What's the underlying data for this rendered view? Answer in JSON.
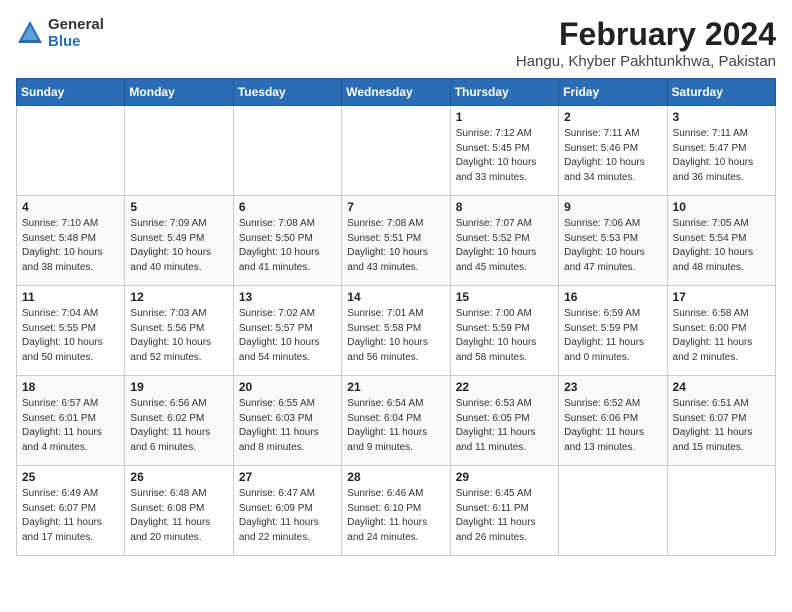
{
  "header": {
    "logo_general": "General",
    "logo_blue": "Blue",
    "month_title": "February 2024",
    "location": "Hangu, Khyber Pakhtunkhwa, Pakistan"
  },
  "days_of_week": [
    "Sunday",
    "Monday",
    "Tuesday",
    "Wednesday",
    "Thursday",
    "Friday",
    "Saturday"
  ],
  "weeks": [
    [
      {
        "day": "",
        "info": ""
      },
      {
        "day": "",
        "info": ""
      },
      {
        "day": "",
        "info": ""
      },
      {
        "day": "",
        "info": ""
      },
      {
        "day": "1",
        "info": "Sunrise: 7:12 AM\nSunset: 5:45 PM\nDaylight: 10 hours\nand 33 minutes."
      },
      {
        "day": "2",
        "info": "Sunrise: 7:11 AM\nSunset: 5:46 PM\nDaylight: 10 hours\nand 34 minutes."
      },
      {
        "day": "3",
        "info": "Sunrise: 7:11 AM\nSunset: 5:47 PM\nDaylight: 10 hours\nand 36 minutes."
      }
    ],
    [
      {
        "day": "4",
        "info": "Sunrise: 7:10 AM\nSunset: 5:48 PM\nDaylight: 10 hours\nand 38 minutes."
      },
      {
        "day": "5",
        "info": "Sunrise: 7:09 AM\nSunset: 5:49 PM\nDaylight: 10 hours\nand 40 minutes."
      },
      {
        "day": "6",
        "info": "Sunrise: 7:08 AM\nSunset: 5:50 PM\nDaylight: 10 hours\nand 41 minutes."
      },
      {
        "day": "7",
        "info": "Sunrise: 7:08 AM\nSunset: 5:51 PM\nDaylight: 10 hours\nand 43 minutes."
      },
      {
        "day": "8",
        "info": "Sunrise: 7:07 AM\nSunset: 5:52 PM\nDaylight: 10 hours\nand 45 minutes."
      },
      {
        "day": "9",
        "info": "Sunrise: 7:06 AM\nSunset: 5:53 PM\nDaylight: 10 hours\nand 47 minutes."
      },
      {
        "day": "10",
        "info": "Sunrise: 7:05 AM\nSunset: 5:54 PM\nDaylight: 10 hours\nand 48 minutes."
      }
    ],
    [
      {
        "day": "11",
        "info": "Sunrise: 7:04 AM\nSunset: 5:55 PM\nDaylight: 10 hours\nand 50 minutes."
      },
      {
        "day": "12",
        "info": "Sunrise: 7:03 AM\nSunset: 5:56 PM\nDaylight: 10 hours\nand 52 minutes."
      },
      {
        "day": "13",
        "info": "Sunrise: 7:02 AM\nSunset: 5:57 PM\nDaylight: 10 hours\nand 54 minutes."
      },
      {
        "day": "14",
        "info": "Sunrise: 7:01 AM\nSunset: 5:58 PM\nDaylight: 10 hours\nand 56 minutes."
      },
      {
        "day": "15",
        "info": "Sunrise: 7:00 AM\nSunset: 5:59 PM\nDaylight: 10 hours\nand 58 minutes."
      },
      {
        "day": "16",
        "info": "Sunrise: 6:59 AM\nSunset: 5:59 PM\nDaylight: 11 hours\nand 0 minutes."
      },
      {
        "day": "17",
        "info": "Sunrise: 6:58 AM\nSunset: 6:00 PM\nDaylight: 11 hours\nand 2 minutes."
      }
    ],
    [
      {
        "day": "18",
        "info": "Sunrise: 6:57 AM\nSunset: 6:01 PM\nDaylight: 11 hours\nand 4 minutes."
      },
      {
        "day": "19",
        "info": "Sunrise: 6:56 AM\nSunset: 6:02 PM\nDaylight: 11 hours\nand 6 minutes."
      },
      {
        "day": "20",
        "info": "Sunrise: 6:55 AM\nSunset: 6:03 PM\nDaylight: 11 hours\nand 8 minutes."
      },
      {
        "day": "21",
        "info": "Sunrise: 6:54 AM\nSunset: 6:04 PM\nDaylight: 11 hours\nand 9 minutes."
      },
      {
        "day": "22",
        "info": "Sunrise: 6:53 AM\nSunset: 6:05 PM\nDaylight: 11 hours\nand 11 minutes."
      },
      {
        "day": "23",
        "info": "Sunrise: 6:52 AM\nSunset: 6:06 PM\nDaylight: 11 hours\nand 13 minutes."
      },
      {
        "day": "24",
        "info": "Sunrise: 6:51 AM\nSunset: 6:07 PM\nDaylight: 11 hours\nand 15 minutes."
      }
    ],
    [
      {
        "day": "25",
        "info": "Sunrise: 6:49 AM\nSunset: 6:07 PM\nDaylight: 11 hours\nand 17 minutes."
      },
      {
        "day": "26",
        "info": "Sunrise: 6:48 AM\nSunset: 6:08 PM\nDaylight: 11 hours\nand 20 minutes."
      },
      {
        "day": "27",
        "info": "Sunrise: 6:47 AM\nSunset: 6:09 PM\nDaylight: 11 hours\nand 22 minutes."
      },
      {
        "day": "28",
        "info": "Sunrise: 6:46 AM\nSunset: 6:10 PM\nDaylight: 11 hours\nand 24 minutes."
      },
      {
        "day": "29",
        "info": "Sunrise: 6:45 AM\nSunset: 6:11 PM\nDaylight: 11 hours\nand 26 minutes."
      },
      {
        "day": "",
        "info": ""
      },
      {
        "day": "",
        "info": ""
      }
    ]
  ]
}
